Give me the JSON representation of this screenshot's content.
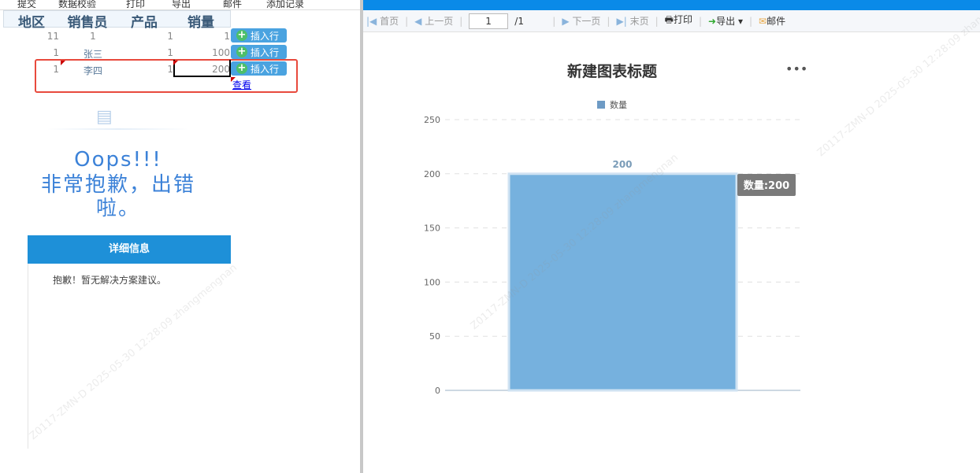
{
  "left_toolbar": [
    "提交",
    "数据校验",
    "打印",
    "导出",
    "邮件",
    "添加记录"
  ],
  "table": {
    "headers": [
      "地区",
      "销售员",
      "产品",
      "销量"
    ],
    "rows": [
      [
        "11",
        "1",
        "1",
        "1"
      ],
      [
        "1",
        "张三",
        "1",
        "100"
      ],
      [
        "1",
        "李四",
        "1",
        "200"
      ]
    ],
    "insert_label": "插入行",
    "view_link": "查看"
  },
  "error": {
    "title": "Oops!!!",
    "message": "非常抱歉，出错啦。",
    "detail_header": "详细信息",
    "detail_text": "抱歉！暂无解决方案建议。"
  },
  "report_toolbar": {
    "first": "首页",
    "prev": "上一页",
    "page": "1",
    "total": "/1",
    "next": "下一页",
    "last": "末页",
    "print": "打印",
    "export": "导出",
    "mail": "邮件"
  },
  "watermark": "Z0117-ZMN-D 2025-05-30 12:28:09 zhangmengnan",
  "chart_data": {
    "type": "bar",
    "title": "新建图表标题",
    "legend": [
      "数量"
    ],
    "legend_position": "top",
    "categories": [
      ""
    ],
    "series": [
      {
        "name": "数量",
        "values": [
          200
        ]
      }
    ],
    "ylim": [
      0,
      250
    ],
    "yticks": [
      0,
      50,
      100,
      150,
      200,
      250
    ],
    "data_labels": [
      "200"
    ],
    "tooltip": "数量:200",
    "color": "#76b1de",
    "grid": true
  }
}
